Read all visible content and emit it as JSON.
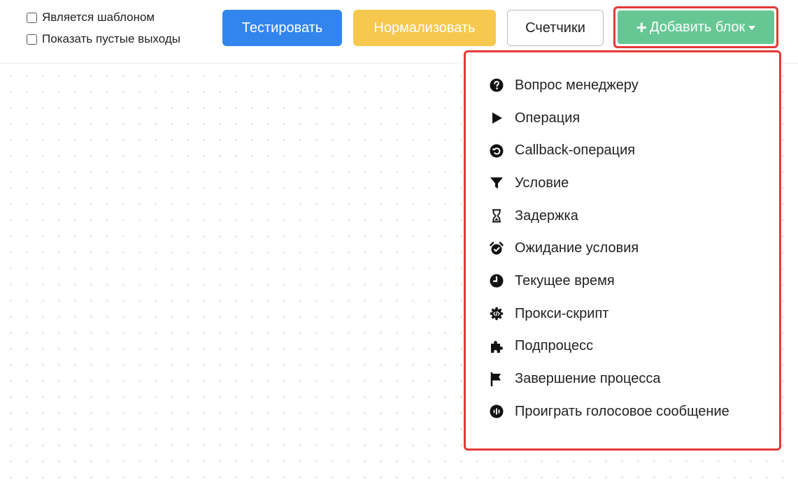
{
  "toolbar": {
    "checkboxes": [
      {
        "label": "Является шаблоном",
        "checked": false
      },
      {
        "label": "Показать пустые выходы",
        "checked": false
      }
    ],
    "test_label": "Тестировать",
    "normalize_label": "Нормализовать",
    "counters_label": "Счетчики",
    "add_block_label": "Добавить блок"
  },
  "colors": {
    "test": "#3385ee",
    "normalize": "#f7c84e",
    "add_block": "#67c794",
    "highlight": "#e53935"
  },
  "menu": {
    "items": [
      {
        "label": "Вопрос менеджеру",
        "icon": "question-circle-icon"
      },
      {
        "label": "Операция",
        "icon": "play-icon"
      },
      {
        "label": "Callback-операция",
        "icon": "undo-circle-icon"
      },
      {
        "label": "Условие",
        "icon": "filter-icon"
      },
      {
        "label": "Задержка",
        "icon": "hourglass-icon"
      },
      {
        "label": "Ожидание условия",
        "icon": "alarm-clock-icon"
      },
      {
        "label": "Текущее время",
        "icon": "clock-icon"
      },
      {
        "label": "Прокси-скрипт",
        "icon": "code-gear-icon"
      },
      {
        "label": "Подпроцесс",
        "icon": "puzzle-icon"
      },
      {
        "label": "Завершение процесса",
        "icon": "flag-icon"
      },
      {
        "label": "Проиграть голосовое сообщение",
        "icon": "voice-message-icon"
      }
    ]
  }
}
